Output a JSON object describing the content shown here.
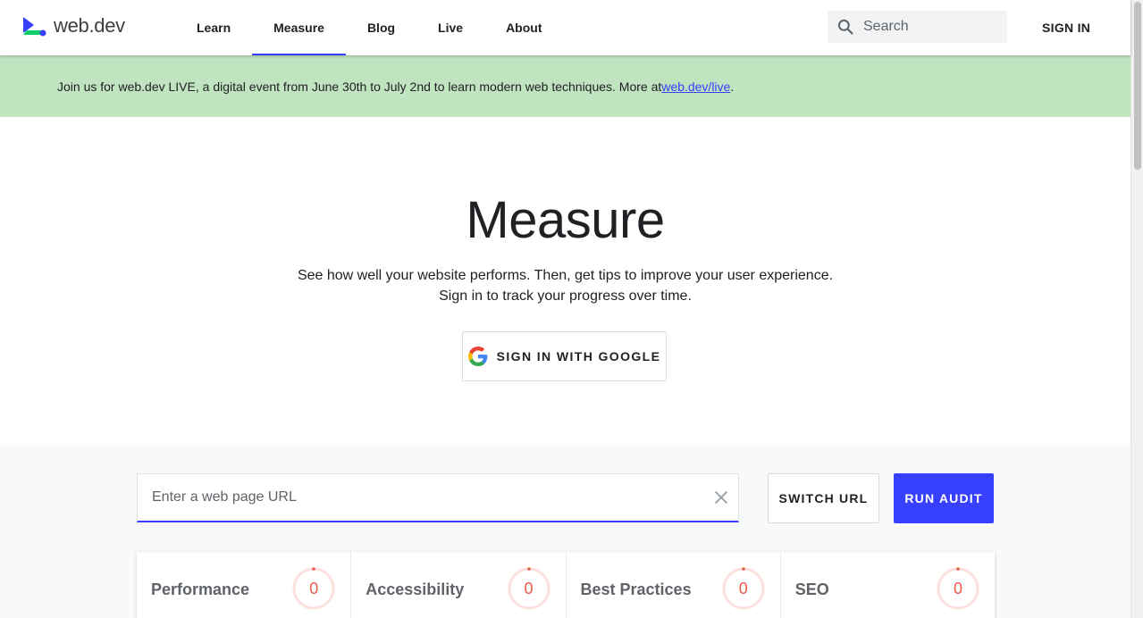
{
  "header": {
    "logo_text": "web.dev",
    "nav": [
      {
        "label": "Learn",
        "active": false
      },
      {
        "label": "Measure",
        "active": true
      },
      {
        "label": "Blog",
        "active": false
      },
      {
        "label": "Live",
        "active": false
      },
      {
        "label": "About",
        "active": false
      }
    ],
    "search_placeholder": "Search",
    "sign_in_label": "SIGN IN"
  },
  "banner": {
    "text": "Join us for web.dev LIVE, a digital event from June 30th to July 2nd to learn modern web techniques. More at ",
    "link_text": "web.dev/live",
    "suffix": "."
  },
  "hero": {
    "title": "Measure",
    "subtitle_line1": "See how well your website performs. Then, get tips to improve your user experience.",
    "subtitle_line2": "Sign in to track your progress over time.",
    "google_button_label": "SIGN IN WITH GOOGLE"
  },
  "audit": {
    "url_placeholder": "Enter a web page URL",
    "switch_url_label": "SWITCH URL",
    "run_audit_label": "RUN AUDIT",
    "scores": [
      {
        "label": "Performance",
        "value": "0"
      },
      {
        "label": "Accessibility",
        "value": "0"
      },
      {
        "label": "Best Practices",
        "value": "0"
      },
      {
        "label": "SEO",
        "value": "0"
      }
    ]
  },
  "colors": {
    "accent": "#3740ff",
    "banner_bg": "#c0e3c0",
    "score_fail": "#eb5a4b"
  }
}
